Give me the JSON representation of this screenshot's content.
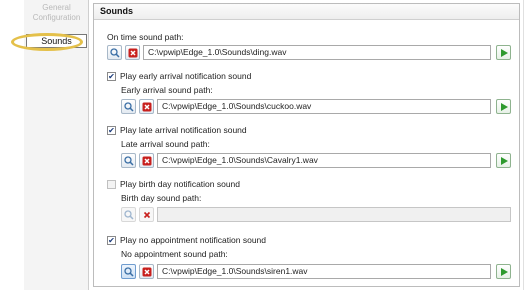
{
  "left_nav": {
    "items": [
      {
        "label": "General"
      },
      {
        "label": "Configuration"
      },
      {
        "label": "Sounds"
      }
    ]
  },
  "panel": {
    "title": "Sounds"
  },
  "sections": {
    "on_time": {
      "label": "On time sound path:",
      "path": "C:\\vpwip\\Edge_1.0\\Sounds\\ding.wav"
    },
    "early": {
      "checkbox_label": "Play early arrival notification sound",
      "checked": true,
      "path_label": "Early arrival sound path:",
      "path": "C:\\vpwip\\Edge_1.0\\Sounds\\cuckoo.wav"
    },
    "late": {
      "checkbox_label": "Play late arrival notification sound",
      "checked": true,
      "path_label": "Late arrival sound path:",
      "path": "C:\\vpwip\\Edge_1.0\\Sounds\\Cavalry1.wav"
    },
    "birthday": {
      "checkbox_label": "Play birth day notification sound",
      "checked": false,
      "path_label": "Birth day sound path:",
      "path": ""
    },
    "no_appt": {
      "checkbox_label": "Play no appointment notification sound",
      "checked": true,
      "path_label": "No appointment sound path:",
      "path": "C:\\vpwip\\Edge_1.0\\Sounds\\siren1.wav"
    }
  },
  "icons": {
    "browse": "magnifier-icon",
    "clear": "red-x-icon",
    "play": "play-icon"
  },
  "colors": {
    "highlight": "#e4c04a",
    "clear_red": "#c8201e",
    "play_green": "#2e9a2e",
    "browse_blue": "#3a6ea5"
  }
}
